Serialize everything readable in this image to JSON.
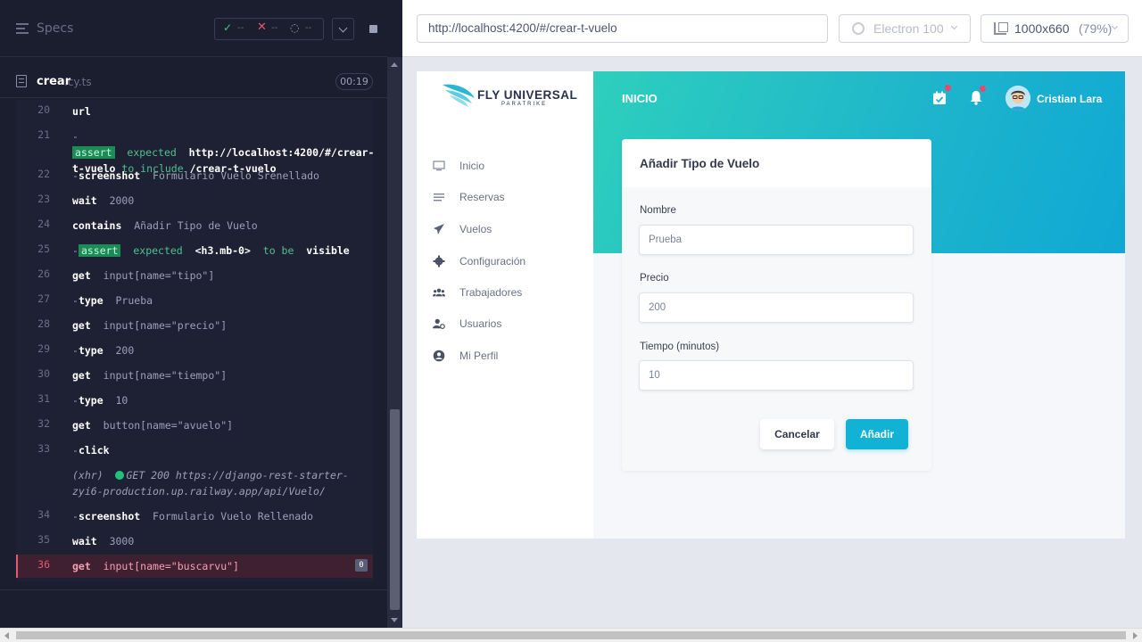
{
  "reporter": {
    "specs_label": "Specs",
    "stats": {
      "passed": "--",
      "failed": "--",
      "pending": "--"
    },
    "file": {
      "name": "crear",
      "ext": ".cy.ts",
      "duration": "00:19"
    },
    "commands": [
      {
        "num": "20",
        "name": "url",
        "msg": ""
      },
      {
        "num": "21",
        "assert": "assert",
        "p1": "expected",
        "s1": "http://localhost:4200/#/crear-t-vuelo",
        "p2": "to include",
        "s2": "/crear-t-vuelo"
      },
      {
        "num": "22",
        "name": "screenshot",
        "msg": "Formulario Vuelo Srenellado"
      },
      {
        "num": "23",
        "name": "wait",
        "msg": "2000"
      },
      {
        "num": "24",
        "name": "contains",
        "msg": "Añadir Tipo de Vuelo"
      },
      {
        "num": "25",
        "assert": "assert",
        "p1": "expected",
        "s1": "<h3.mb-0>",
        "p2": "to be",
        "s2": "visible"
      },
      {
        "num": "26",
        "name": "get",
        "msg": "input[name=\"tipo\"]"
      },
      {
        "num": "27",
        "name": "type",
        "msg": "Prueba"
      },
      {
        "num": "28",
        "name": "get",
        "msg": "input[name=\"precio\"]"
      },
      {
        "num": "29",
        "name": "type",
        "msg": "200"
      },
      {
        "num": "30",
        "name": "get",
        "msg": "input[name=\"tiempo\"]"
      },
      {
        "num": "31",
        "name": "type",
        "msg": "10"
      },
      {
        "num": "32",
        "name": "get",
        "msg": "button[name=\"avuelo\"]"
      },
      {
        "num": "33",
        "name": "click",
        "msg": ""
      },
      {
        "num": "",
        "xhr": "(xhr)",
        "xhr_msg": "GET 200 https://django-rest-starter-zyi6-production.up.railway.app/api/Vuelo/"
      },
      {
        "num": "34",
        "name": "screenshot",
        "msg": "Formulario Vuelo Rellenado"
      },
      {
        "num": "35",
        "name": "wait",
        "msg": "3000"
      },
      {
        "num": "36",
        "name": "get",
        "msg": "input[name=\"buscarvu\"]",
        "badge": "0"
      }
    ]
  },
  "runner": {
    "url": "http://localhost:4200/#/crear-t-vuelo",
    "browser": "Electron 100",
    "viewport": "1000x660",
    "zoom": "(79%)"
  },
  "app": {
    "logo": {
      "title": "FLY UNIVERSAL",
      "subtitle": "PARATRIKE"
    },
    "nav": [
      {
        "label": "Inicio",
        "icon": "monitor-icon"
      },
      {
        "label": "Reservas",
        "icon": "list-icon"
      },
      {
        "label": "Vuelos",
        "icon": "paper-plane-icon"
      },
      {
        "label": "Configuración",
        "icon": "cog-icon"
      },
      {
        "label": "Trabajadores",
        "icon": "users-icon"
      },
      {
        "label": "Usuarios",
        "icon": "user-cog-icon"
      },
      {
        "label": "Mi Perfil",
        "icon": "user-circle-icon"
      }
    ],
    "header": {
      "title": "INICIO",
      "user": "Cristian Lara"
    },
    "form": {
      "title": "Añadir Tipo de Vuelo",
      "fields": [
        {
          "label": "Nombre",
          "value": "Prueba"
        },
        {
          "label": "Precio",
          "value": "200"
        },
        {
          "label": "Tiempo (minutos)",
          "value": "10"
        }
      ],
      "cancel": "Cancelar",
      "submit": "Añadir"
    }
  },
  "colors": {
    "accent": "#11b2d4",
    "assert": "#1c8c56",
    "fail": "#e45770",
    "pass": "#4ec28f"
  }
}
